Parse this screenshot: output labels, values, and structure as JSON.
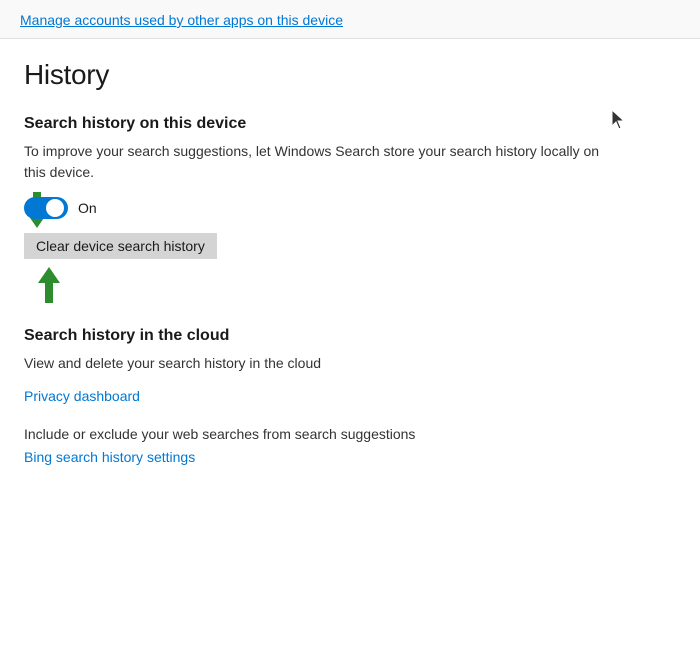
{
  "top_link": {
    "text": "Manage accounts used by other apps on this device"
  },
  "history_section": {
    "title": "History",
    "device_subsection": {
      "title": "Search history on this device",
      "description": "To improve your search suggestions, let Windows Search store your search history locally on this device.",
      "toggle_state": "On",
      "toggle_on": true
    },
    "clear_button": {
      "label": "Clear device search history"
    },
    "cloud_subsection": {
      "title": "Search history in the cloud",
      "description": "View and delete your search history in the cloud",
      "link_text": "Privacy dashboard",
      "sub_description": "Include or exclude your web searches from search suggestions",
      "sub_link_text": "Bing search history settings"
    }
  }
}
